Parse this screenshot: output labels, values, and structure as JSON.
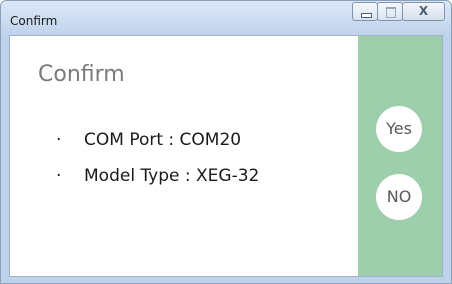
{
  "window": {
    "title": "Confirm"
  },
  "dialog": {
    "heading": "Confirm",
    "items": [
      {
        "bullet": "·",
        "text": "COM Port : COM20"
      },
      {
        "bullet": "·",
        "text": "Model Type : XEG-32"
      }
    ]
  },
  "buttons": {
    "yes_label": "Yes",
    "no_label": "NO"
  },
  "caption_buttons": {
    "close_glyph": "X"
  },
  "colors": {
    "side_panel": "#9dcfac",
    "heading_text": "#7a7a7a"
  }
}
